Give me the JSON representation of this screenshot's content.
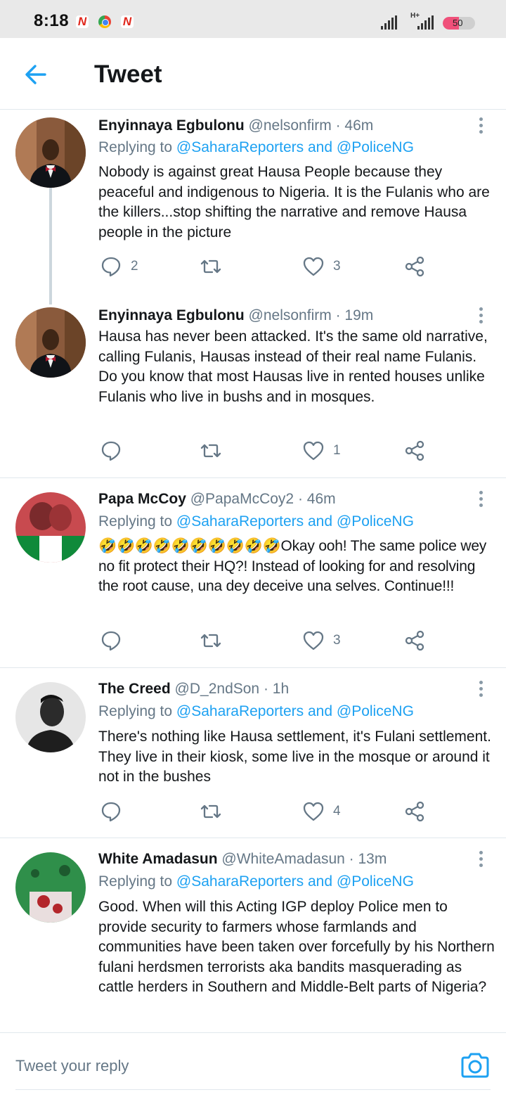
{
  "status_bar": {
    "time": "8:18",
    "apps": [
      "news-n-icon",
      "chrome-icon",
      "news-n-icon"
    ],
    "app_letter": "N",
    "network_label": "H+",
    "battery_percent": 50,
    "battery_label": "50",
    "battery_color": "#f0507a"
  },
  "header": {
    "title": "Tweet",
    "back_icon": "arrow-left-icon",
    "accent": "#1da1f2"
  },
  "tweets": [
    {
      "name": "Enyinnaya Egbulonu",
      "handle": "@nelsonfirm",
      "time": "· 46m",
      "replying_prefix": "Replying to",
      "mention1": "@SaharaReporters",
      "and": "and",
      "mention2": "@PoliceNG",
      "text": "Nobody is against great Hausa People because they peaceful and indigenous to Nigeria. It is the Fulanis who are the killers...stop shifting the narrative and remove Hausa people in the picture",
      "replies": "2",
      "retweets": "",
      "likes": "3"
    },
    {
      "name": "Enyinnaya Egbulonu",
      "handle": "@nelsonfirm",
      "time": "· 19m",
      "text": "Hausa has never been attacked. It's the same old narrative, calling Fulanis, Hausas instead of their real name Fulanis. Do you know that most Hausas live in rented houses unlike Fulanis who live in bushs and in mosques.",
      "replies": "",
      "retweets": "",
      "likes": "1"
    },
    {
      "name": "Papa McCoy",
      "handle": "@PapaMcCoy2",
      "time": "· 46m",
      "replying_prefix": "Replying to",
      "mention1": "@SaharaReporters",
      "and": "and",
      "mention2": "@PoliceNG",
      "text": "🤣🤣🤣🤣🤣🤣🤣🤣🤣🤣Okay ooh! The same police wey no fit protect their HQ?! Instead of looking for and resolving the root cause, una dey deceive una selves. Continue!!!",
      "replies": "",
      "retweets": "",
      "likes": "3"
    },
    {
      "name": "The Creed",
      "handle": "@D_2ndSon",
      "time": "· 1h",
      "replying_prefix": "Replying to",
      "mention1": "@SaharaReporters",
      "and": "and",
      "mention2": "@PoliceNG",
      "text": "There's nothing like Hausa settlement, it's Fulani settlement. They live in their kiosk, some live in the mosque or around it not in the bushes",
      "replies": "",
      "retweets": "",
      "likes": "4"
    },
    {
      "name": "White Amadasun",
      "handle": "@WhiteAmadasun",
      "time": "· 13m",
      "replying_prefix": "Replying to",
      "mention1": "@SaharaReporters",
      "and": "and",
      "mention2": "@PoliceNG",
      "text": "Good. When will this Acting IGP deploy Police men to provide security to farmers whose farmlands and communities have been taken over forcefully by his Northern fulani herdsmen terrorists aka bandits masquerading as cattle herders in Southern and Middle-Belt parts of Nigeria?"
    }
  ],
  "reply_bar": {
    "placeholder": "Tweet your reply",
    "camera_icon": "camera-icon"
  }
}
